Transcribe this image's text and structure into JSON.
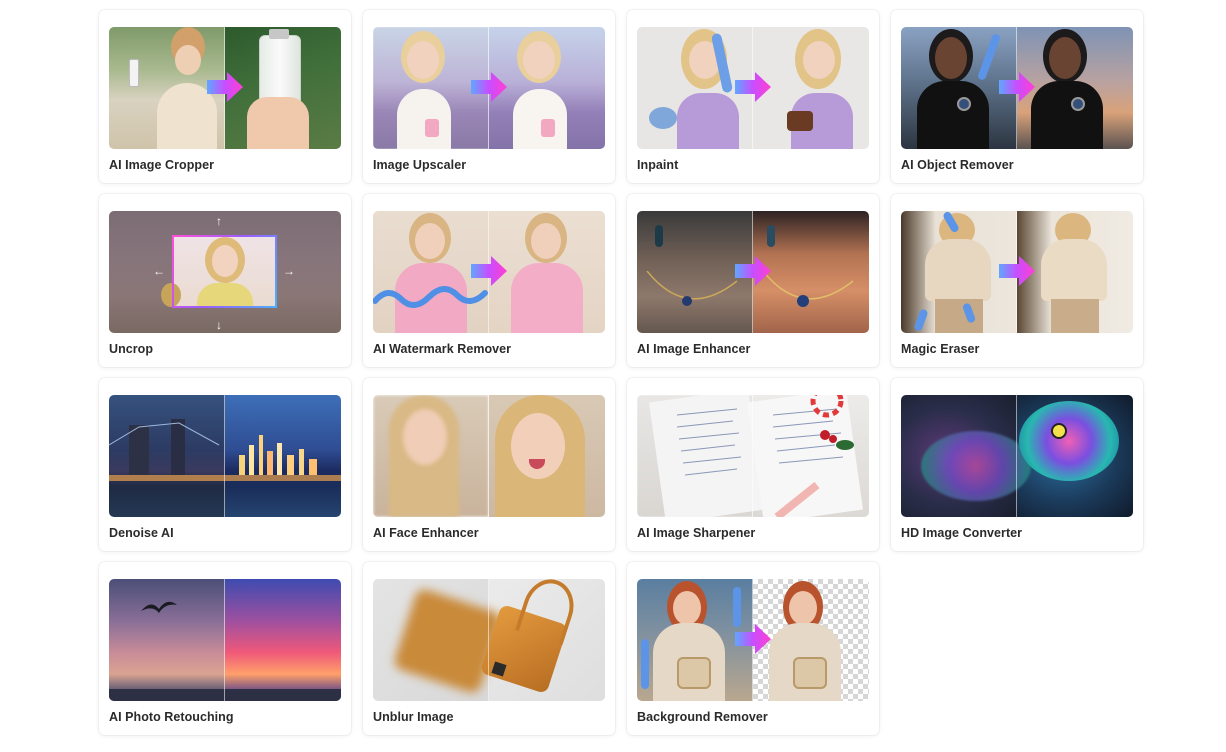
{
  "tools": [
    {
      "name": "AI Image Cropper"
    },
    {
      "name": "Image Upscaler"
    },
    {
      "name": "Inpaint"
    },
    {
      "name": "AI Object Remover"
    },
    {
      "name": "Uncrop"
    },
    {
      "name": "AI Watermark Remover"
    },
    {
      "name": "AI Image Enhancer"
    },
    {
      "name": "Magic Eraser"
    },
    {
      "name": "Denoise AI"
    },
    {
      "name": "AI Face Enhancer"
    },
    {
      "name": "AI Image Sharpener"
    },
    {
      "name": "HD Image Converter"
    },
    {
      "name": "AI Photo Retouching"
    },
    {
      "name": "Unblur Image"
    },
    {
      "name": "Background Remover"
    }
  ],
  "colors": {
    "arrow_gradient_start": "#ff3fd2",
    "arrow_gradient_end": "#5f8cff",
    "card_title": "#2b2b2b"
  }
}
